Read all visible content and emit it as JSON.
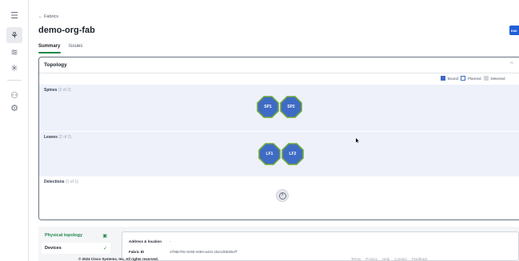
{
  "sidebar": {
    "items": [
      {
        "icon": "menu-icon",
        "glyph": "☰"
      },
      {
        "icon": "fabrics-icon",
        "glyph": "⚘",
        "active": true
      },
      {
        "icon": "layers-icon",
        "glyph": "≋"
      },
      {
        "icon": "network-icon",
        "glyph": "✳"
      },
      {
        "icon": "users-icon",
        "glyph": "⚇"
      },
      {
        "icon": "settings-icon",
        "glyph": "⚙"
      }
    ]
  },
  "header": {
    "back_label": "← Fabrics",
    "title": "demo-org-fab",
    "edit_label": "Edit"
  },
  "tabs": [
    {
      "label": "Summary",
      "active": true
    },
    {
      "label": "Issues",
      "active": false
    }
  ],
  "topology": {
    "title": "Topology",
    "collapse_glyph": "^",
    "legend": {
      "bound": "Bound",
      "planned": "Planned",
      "detected": "Detected"
    },
    "spines": {
      "label": "Spines",
      "count": "(2 of 2)",
      "nodes": [
        "SP1",
        "SP2"
      ]
    },
    "leaves": {
      "label": "Leaves",
      "count": "(2 of 2)",
      "nodes": [
        "LF1",
        "LF2"
      ]
    },
    "detections": {
      "label": "Detections",
      "count": "(1 of 1)",
      "glyph": "?"
    }
  },
  "bottom": {
    "nav": {
      "physical_topology": "Physical topology",
      "devices": "Devices"
    },
    "details": {
      "address_key": "Address & location",
      "address_value": "-",
      "fabric_id_key": "Fabric ID",
      "fabric_id_value": "479de78c-0c50-4494-a441-c5e125530a7f"
    }
  },
  "footer": {
    "copyright": "© 2024 Cisco Systems, Inc. All rights reserved.",
    "links": [
      "Terms",
      "Privacy",
      "Help",
      "Contact",
      "Feedback"
    ]
  },
  "colors": {
    "accent_green": "#1d8a4a",
    "node_blue": "#3f6bc4",
    "node_border_green": "#6fa83a",
    "primary_button": "#1e5fd9"
  }
}
